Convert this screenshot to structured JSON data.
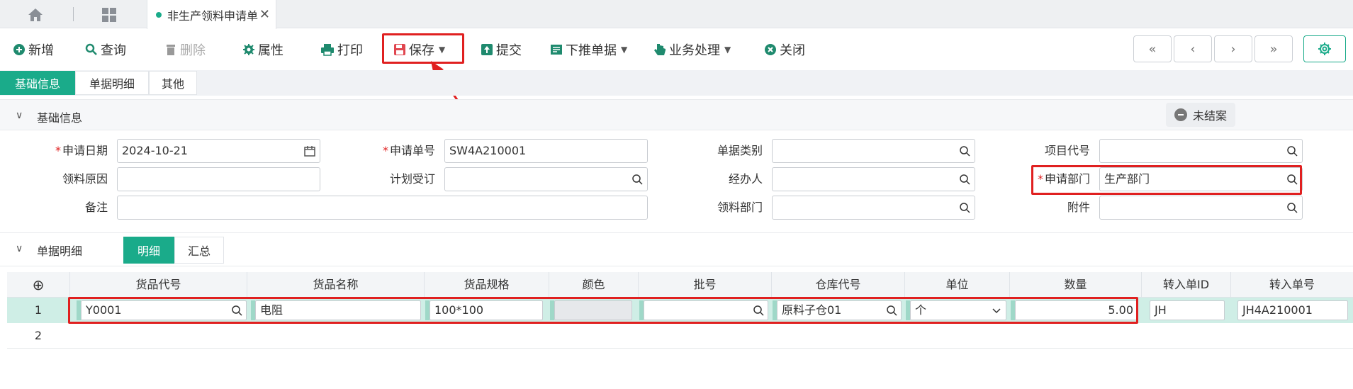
{
  "tab": {
    "title": "非生产领料申请单",
    "close": "✕"
  },
  "toolbar": {
    "new": "新增",
    "query": "查询",
    "delete": "删除",
    "properties": "属性",
    "print": "打印",
    "save": "保存",
    "submit": "提交",
    "push_down": "下推单据",
    "business": "业务处理",
    "close": "关闭"
  },
  "nav": {
    "first": "«",
    "prev": "‹",
    "next": "›",
    "last": "»"
  },
  "subtabs": [
    "基础信息",
    "单据明细",
    "其他"
  ],
  "section_basic": "基础信息",
  "status_badge": "未结案",
  "form": {
    "apply_date_label": "申请日期",
    "apply_date": "2024-10-21",
    "apply_no_label": "申请单号",
    "apply_no": "SW4A210001",
    "doc_type_label": "单据类别",
    "doc_type": "",
    "project_label": "项目代号",
    "project": "",
    "reason_label": "领料原因",
    "reason": "",
    "plan_label": "计划受订",
    "plan": "",
    "handler_label": "经办人",
    "handler": "",
    "dept_label": "申请部门",
    "dept": "生产部门",
    "remark_label": "备注",
    "remark": "",
    "pick_dept_label": "领料部门",
    "pick_dept": "",
    "attach_label": "附件",
    "attach": ""
  },
  "section_detail": "单据明细",
  "detail_tabs": [
    "明细",
    "汇总"
  ],
  "grid": {
    "add": "⊕",
    "columns": [
      "货品代号",
      "货品名称",
      "货品规格",
      "颜色",
      "批号",
      "仓库代号",
      "单位",
      "数量",
      "转入单ID",
      "转入单号"
    ],
    "rows": [
      {
        "num": "1",
        "code": "Y0001",
        "name": "电阻",
        "spec": "100*100",
        "color": "",
        "batch": "",
        "warehouse": "原料子仓01",
        "unit": "个",
        "qty": "5.00",
        "src_id": "JH",
        "src_no": "JH4A210001"
      },
      {
        "num": "2"
      }
    ]
  },
  "colors": {
    "accent": "#1aab8a",
    "highlight": "#e02020",
    "row_selected": "#cfeee6"
  }
}
